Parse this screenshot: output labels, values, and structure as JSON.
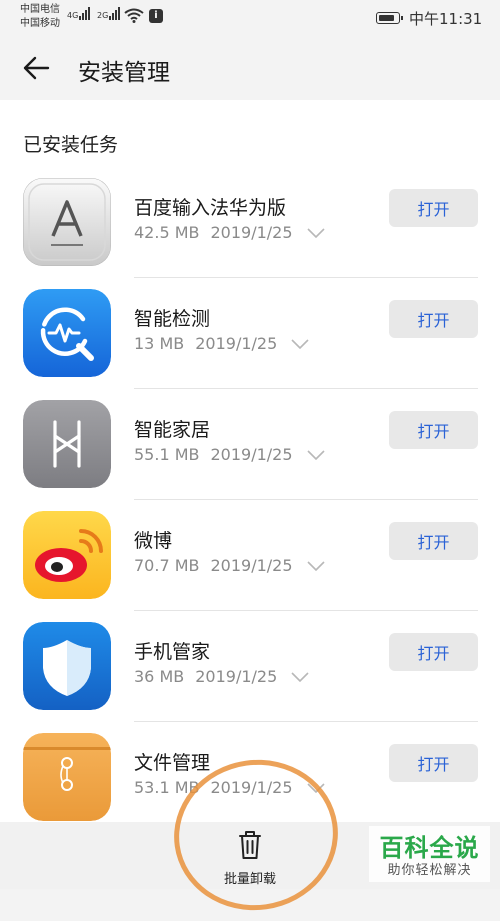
{
  "status_bar": {
    "carrier_1": "中国电信",
    "carrier_2": "中国移动",
    "network_1": "4G",
    "network_2": "2G",
    "time": "中午11:31"
  },
  "header": {
    "back_icon": "arrow-left-icon",
    "title": "安装管理"
  },
  "section": {
    "title": "已安装任务"
  },
  "apps": [
    {
      "name": "百度输入法华为版",
      "size": "42.5 MB",
      "date": "2019/1/25",
      "button": "打开",
      "icon": "baidu-input-icon"
    },
    {
      "name": "智能检测",
      "size": "13 MB",
      "date": "2019/1/25",
      "button": "打开",
      "icon": "smart-detect-icon"
    },
    {
      "name": "智能家居",
      "size": "55.1 MB",
      "date": "2019/1/25",
      "button": "打开",
      "icon": "smart-home-icon"
    },
    {
      "name": "微博",
      "size": "70.7 MB",
      "date": "2019/1/25",
      "button": "打开",
      "icon": "weibo-icon"
    },
    {
      "name": "手机管家",
      "size": "36 MB",
      "date": "2019/1/25",
      "button": "打开",
      "icon": "phone-manager-icon"
    },
    {
      "name": "文件管理",
      "size": "53.1 MB",
      "date": "2019/1/25",
      "button": "打开",
      "icon": "file-manager-icon"
    }
  ],
  "bottom_bar": {
    "batch_uninstall_label": "批量卸载",
    "icon": "trash-icon"
  },
  "watermark": {
    "title": "百科全说",
    "subtitle": "助你轻松解决"
  },
  "colors": {
    "accent": "#2a62d6",
    "annotation": "#e9923c",
    "watermark_green": "#2aa84a"
  }
}
